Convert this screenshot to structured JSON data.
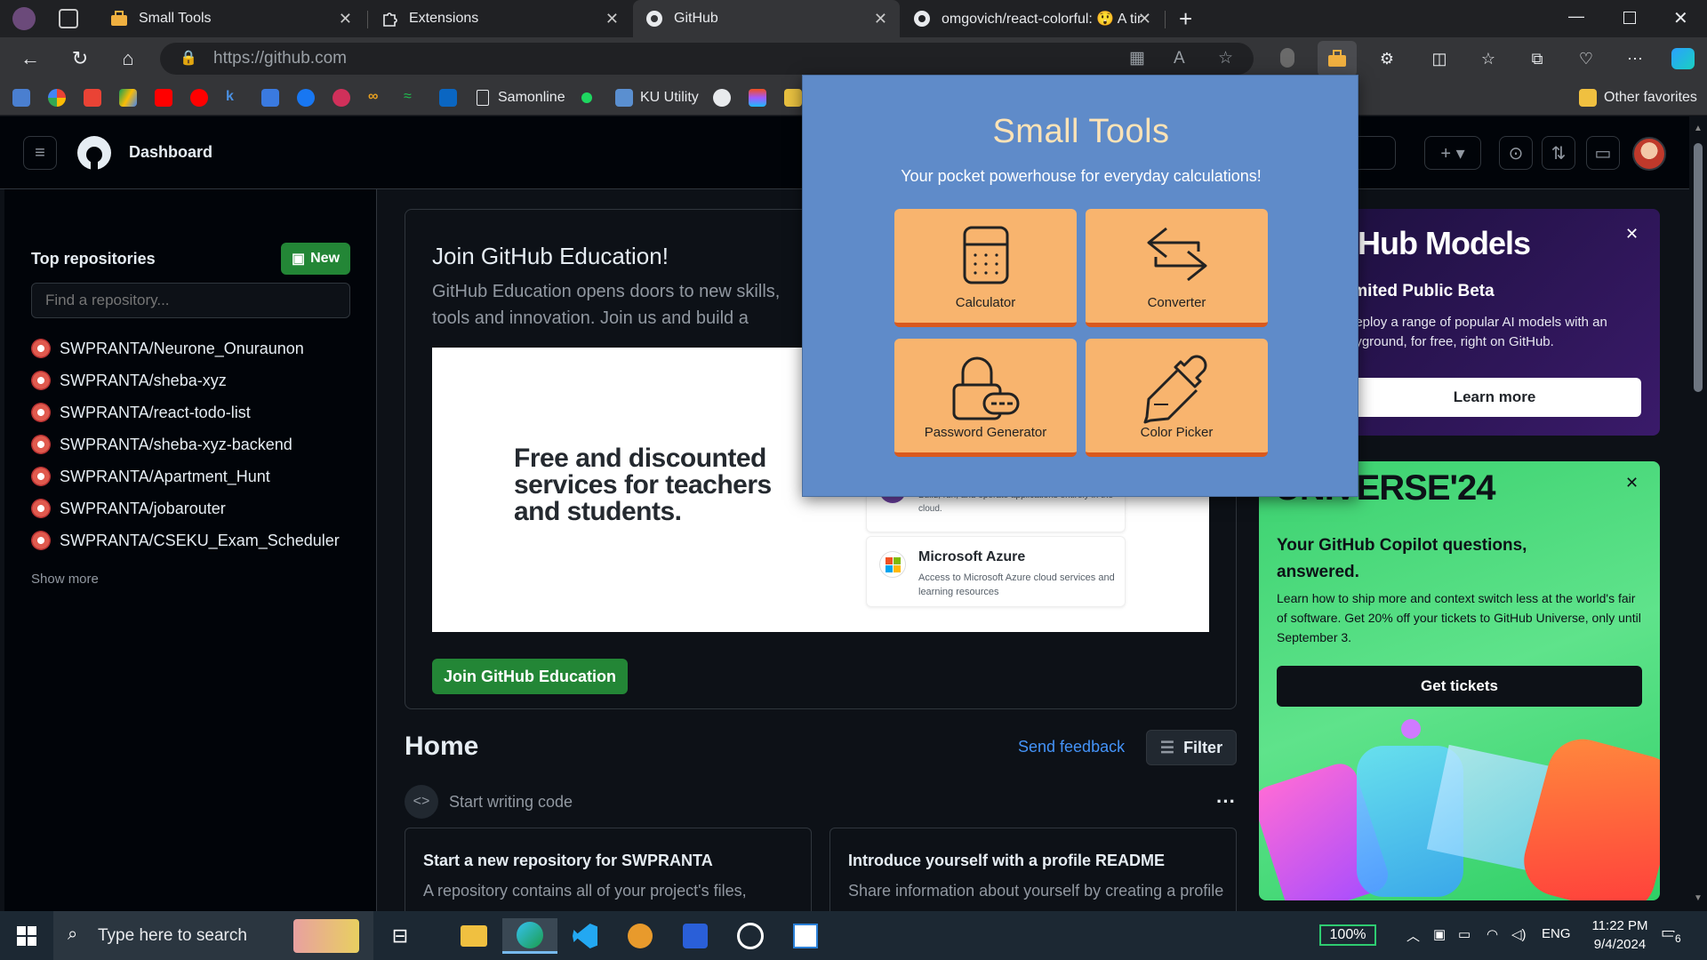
{
  "browser": {
    "tabs": [
      {
        "title": "Small Tools"
      },
      {
        "title": "Extensions"
      },
      {
        "title": "GitHub"
      },
      {
        "title": "omgovich/react-colorful: 😲 A tin"
      }
    ],
    "url": "https://github.com",
    "favorites": [
      {
        "label": "Samonline"
      },
      {
        "label": "KU Utility"
      },
      {
        "label": "Other favorites"
      }
    ]
  },
  "github": {
    "header_title": "Dashboard",
    "sidebar": {
      "heading": "Top repositories",
      "new_label": "New",
      "find_placeholder": "Find a repository...",
      "repos": [
        "SWPRANTA/Neurone_Onuraunon",
        "SWPRANTA/sheba-xyz",
        "SWPRANTA/react-todo-list",
        "SWPRANTA/sheba-xyz-backend",
        "SWPRANTA/Apartment_Hunt",
        "SWPRANTA/jobarouter",
        "SWPRANTA/CSEKU_Exam_Scheduler"
      ],
      "show_more": "Show more"
    },
    "education": {
      "title": "Join GitHub Education!",
      "desc": "GitHub Education opens doors to new skills, tools and innovation. Join us and build a foundation for y",
      "image_heading": "Free and discounted services for teachers and students.",
      "cards": [
        {
          "title": "",
          "desc": "Build, run, and operate applications entirely in the cloud."
        },
        {
          "title": "Microsoft Azure",
          "desc": "Access to Microsoft Azure cloud services and learning resources"
        }
      ],
      "button": "Join GitHub Education"
    },
    "home": {
      "title": "Home",
      "feedback": "Send feedback",
      "filter": "Filter",
      "start_writing": "Start writing code",
      "cards": [
        {
          "title": "Start a new repository for SWPRANTA",
          "desc": "A repository contains all of your project's files,"
        },
        {
          "title": "Introduce yourself with a profile README",
          "desc": "Share information about yourself by creating a profile"
        }
      ]
    },
    "models": {
      "title": "tHub Models",
      "subtitle": "imited Public Beta",
      "desc": "deploy a range of popular AI models with an ayground, for free, right on GitHub.",
      "button": "Learn more"
    },
    "universe": {
      "title": "UNIVERSE'24",
      "subtitle": "Your GitHub Copilot questions, answered.",
      "desc": "Learn how to ship more and context switch less at the world's fair of software. Get 20% off your tickets to GitHub Universe, only until September 3.",
      "button": "Get tickets"
    }
  },
  "popup": {
    "title": "Small Tools",
    "subtitle": "Your pocket powerhouse for everyday calculations!",
    "tools": [
      {
        "label": "Calculator",
        "icon": "calculator-icon"
      },
      {
        "label": "Converter",
        "icon": "arrows-icon"
      },
      {
        "label": "Password Generator",
        "icon": "lock-icon"
      },
      {
        "label": "Color Picker",
        "icon": "eyedropper-icon"
      }
    ],
    "colors": {
      "bg": "#5f8bc9",
      "tile": "#f8b46e",
      "tile_border": "#d9591d",
      "title": "#fde3b6"
    }
  },
  "taskbar": {
    "search_placeholder": "Type here to search",
    "battery": "100%",
    "lang": "ENG",
    "time": "11:22 PM",
    "date": "9/4/2024",
    "notifications": "6"
  }
}
